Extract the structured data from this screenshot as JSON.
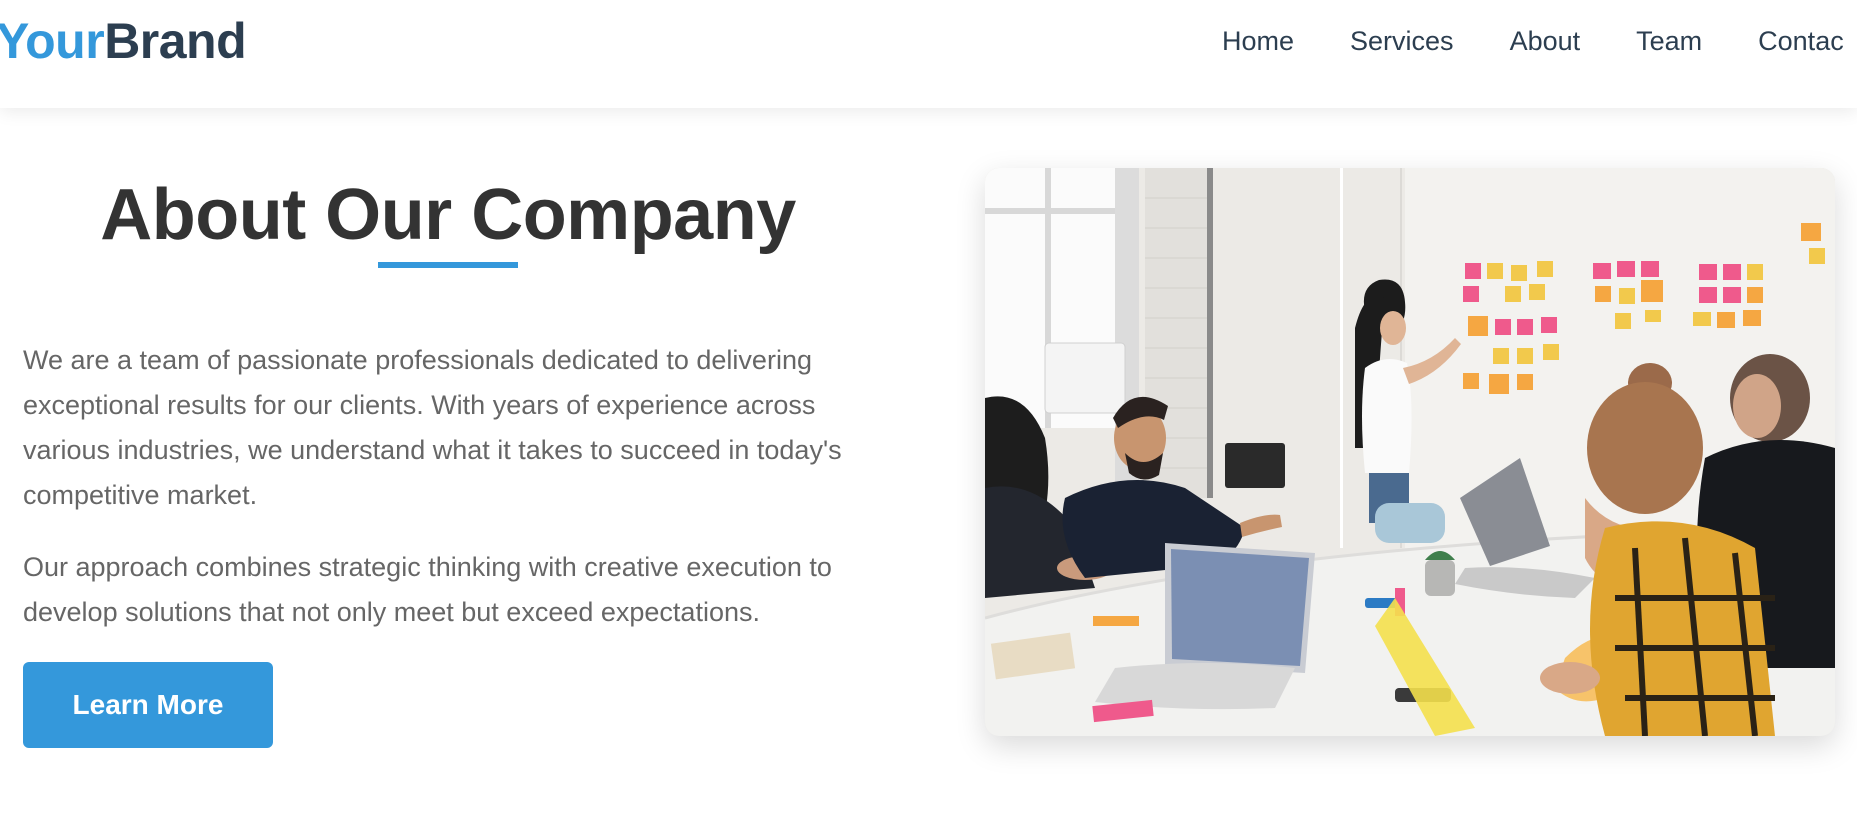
{
  "header": {
    "logo": {
      "part1": "Your",
      "part2": "Brand"
    },
    "nav": [
      "Home",
      "Services",
      "About",
      "Team",
      "Contac"
    ]
  },
  "about": {
    "title": "About Our Company",
    "paragraphs": [
      "We are a team of passionate professionals dedicated to delivering exceptional results for our clients. With years of experience across various industries, we understand what it takes to succeed in today's competitive market.",
      "Our approach combines strategic thinking with creative execution to develop solutions that not only meet but exceed expectations."
    ],
    "button_label": "Learn More"
  },
  "image": {
    "subject": "team-meeting-photo"
  },
  "colors": {
    "accent": "#3498db",
    "brand_dark": "#2c3e50",
    "heading": "#333333",
    "body_text": "#666666"
  }
}
